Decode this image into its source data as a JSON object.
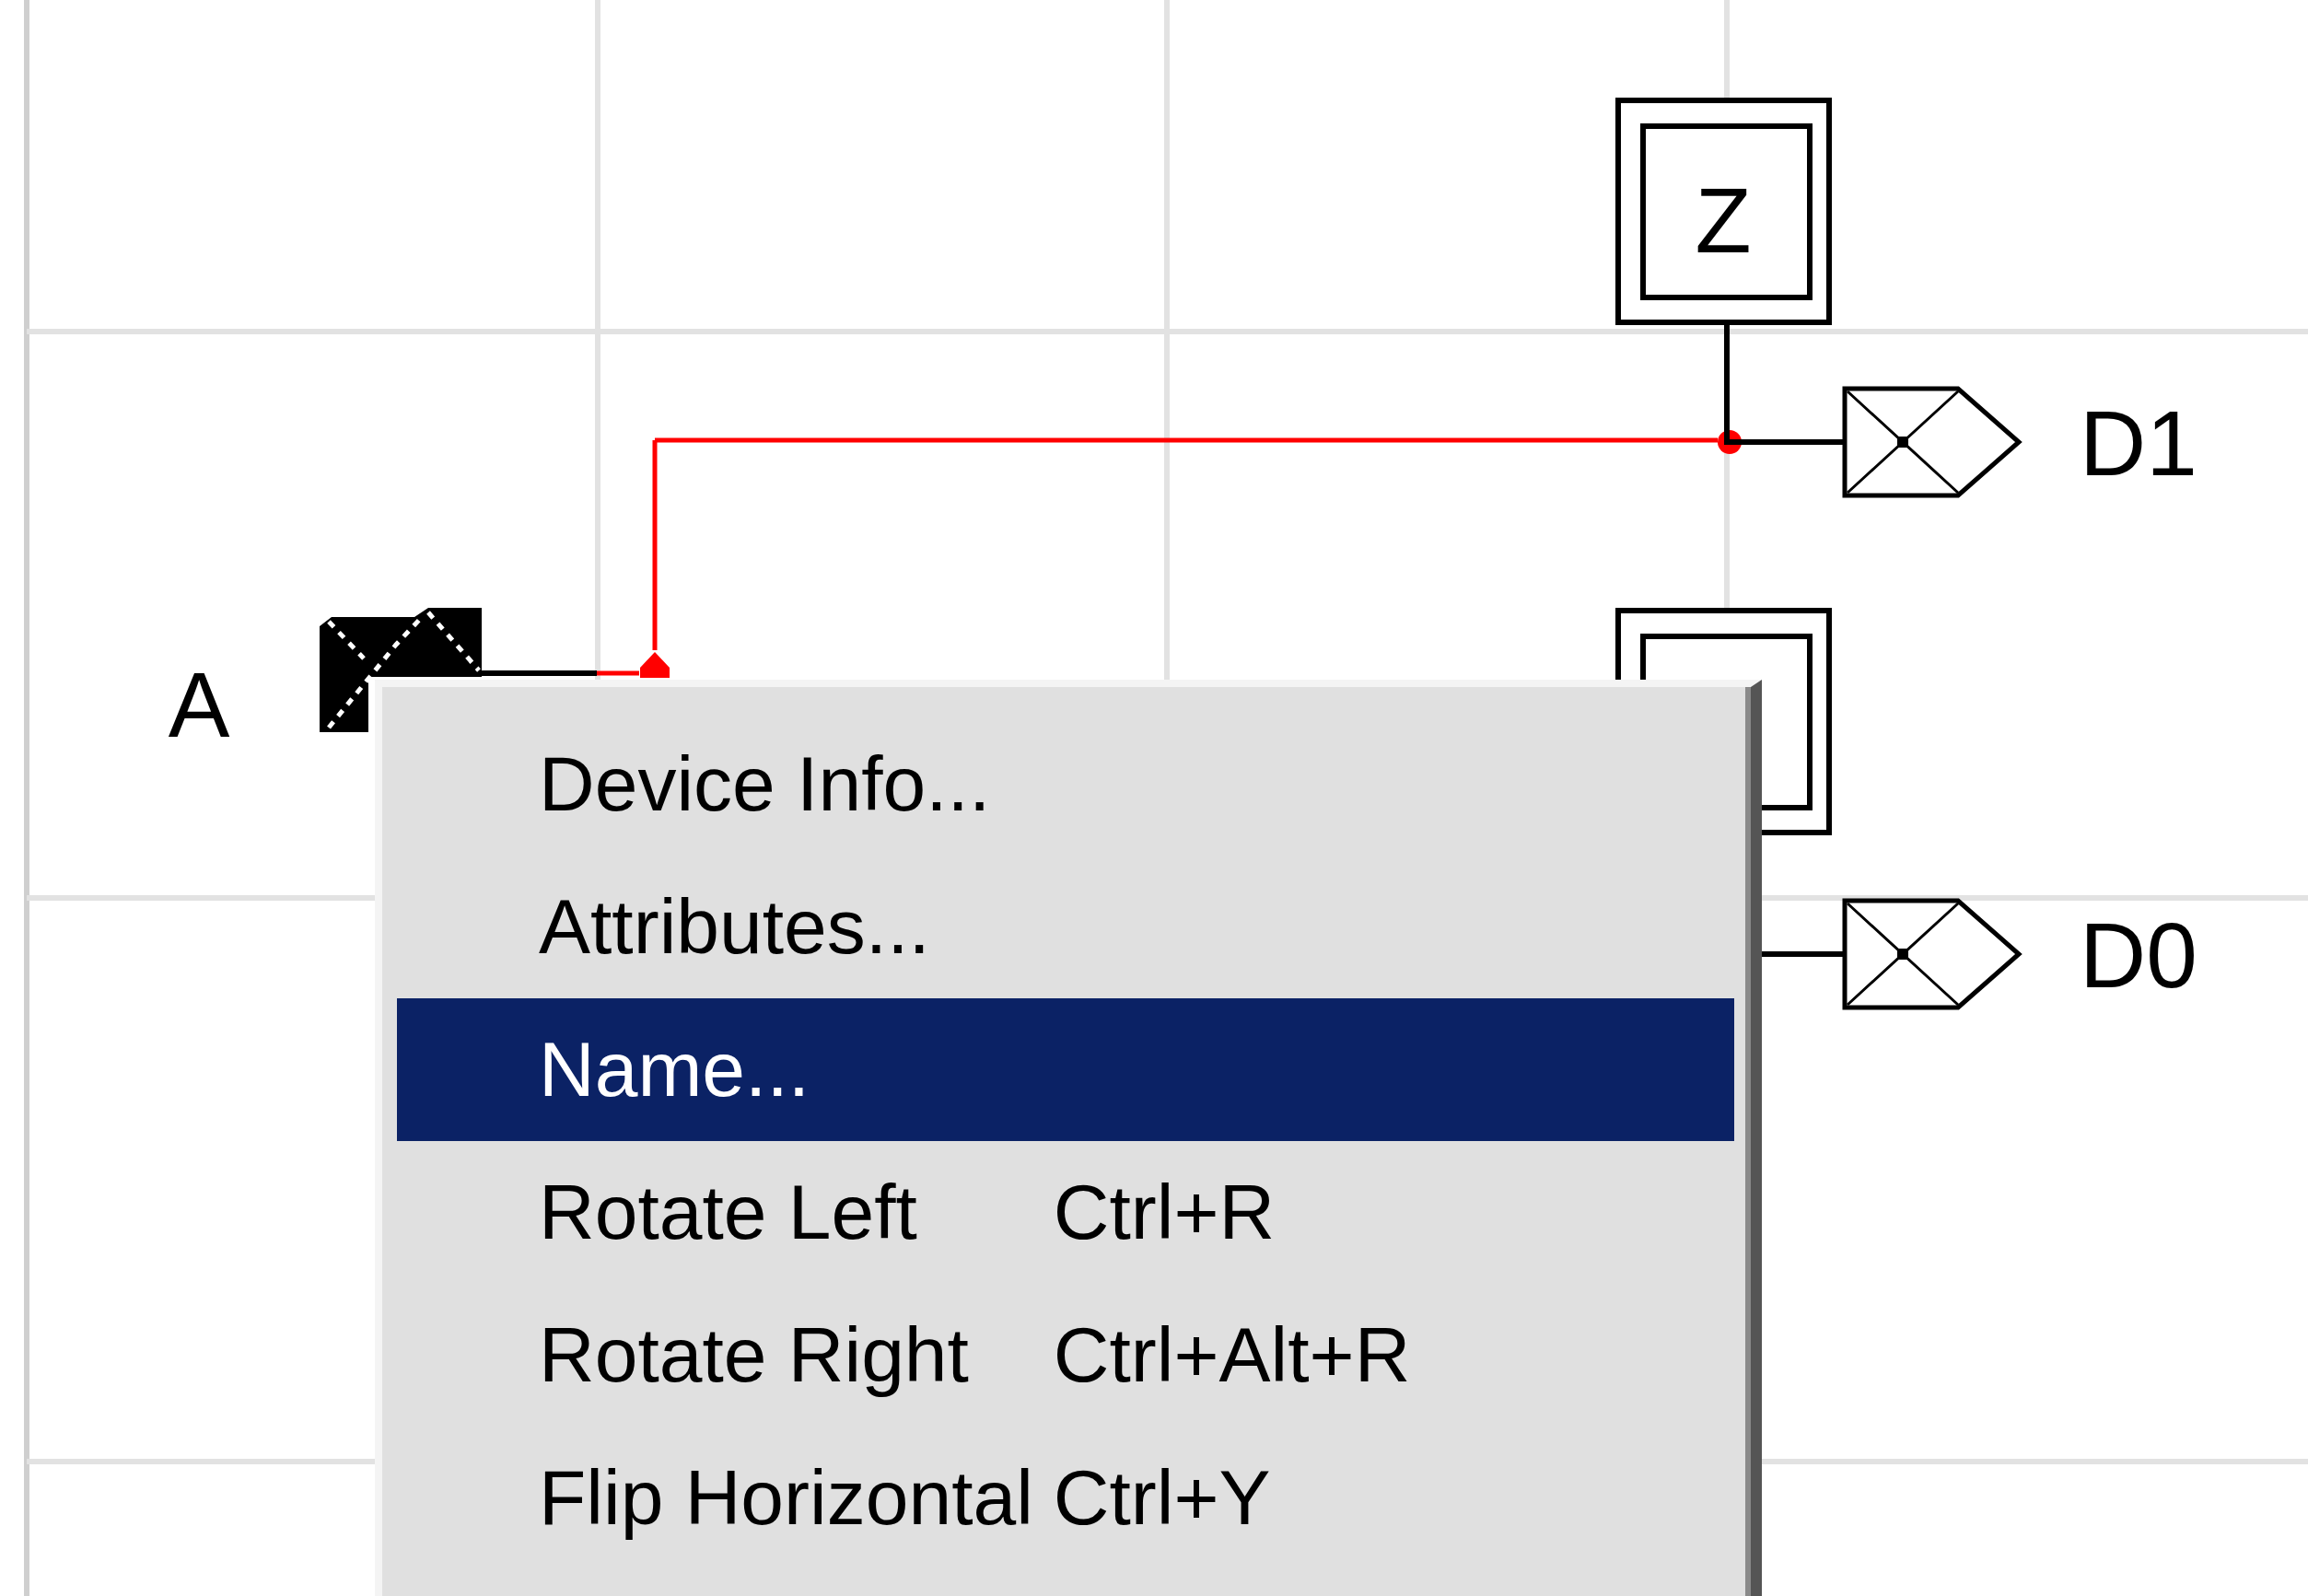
{
  "schematic": {
    "inputs": [
      {
        "label": "A"
      }
    ],
    "blocks": [
      {
        "kind": "labeled",
        "label": "Z"
      },
      {
        "kind": "covered"
      }
    ],
    "outputs": [
      {
        "label": "D1"
      },
      {
        "label": "D0"
      }
    ]
  },
  "context_menu": {
    "items": [
      {
        "label": "Device Info...",
        "selected": false
      },
      {
        "label": "Attributes...",
        "selected": false
      },
      {
        "label": "Name...",
        "selected": true
      },
      {
        "label": "Rotate Left",
        "shortcut": "Ctrl+R",
        "selected": false
      },
      {
        "label": "Rotate Right",
        "shortcut": "Ctrl+Alt+R",
        "selected": false
      },
      {
        "label": "Flip Horizontal",
        "shortcut": "Ctrl+Y",
        "selected": false
      }
    ]
  }
}
